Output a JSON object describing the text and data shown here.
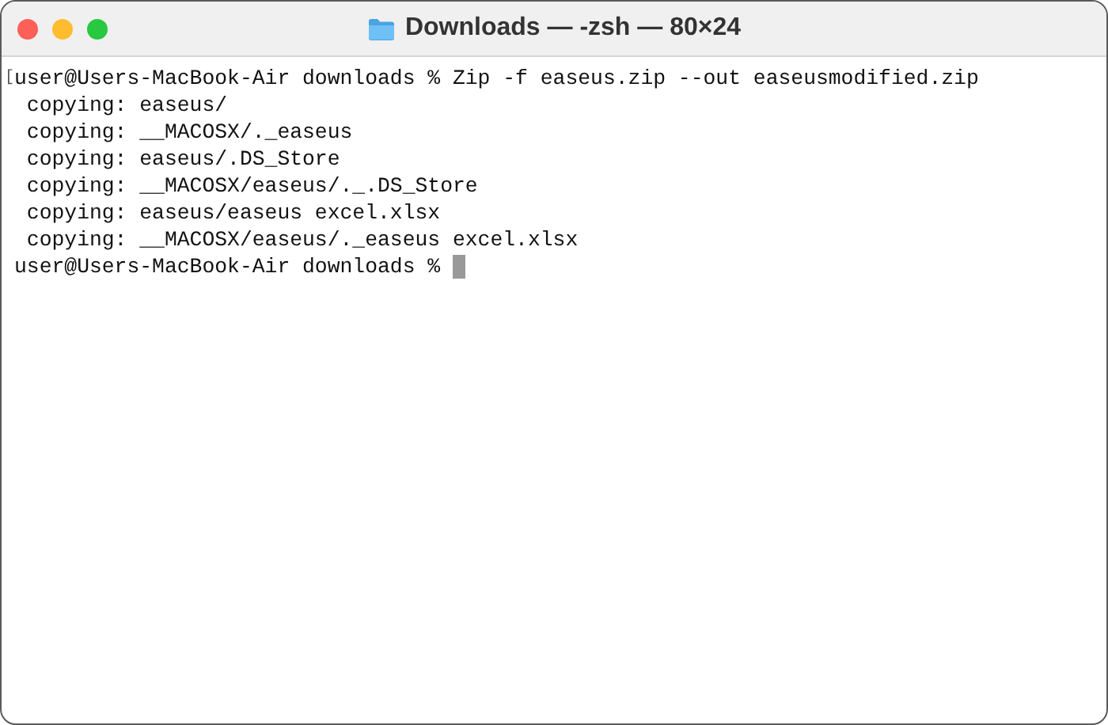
{
  "window": {
    "title": "Downloads — -zsh — 80×24"
  },
  "terminal": {
    "mark": "[",
    "lines": [
      {
        "text": "user@Users-MacBook-Air downloads % Zip -f easeus.zip --out easeusmodified.zip",
        "marked": true
      },
      {
        "text": " copying: easeus/",
        "marked": false
      },
      {
        "text": " copying: __MACOSX/._easeus",
        "marked": false
      },
      {
        "text": " copying: easeus/.DS_Store",
        "marked": false
      },
      {
        "text": " copying: __MACOSX/easeus/._.DS_Store",
        "marked": false
      },
      {
        "text": " copying: easeus/easeus excel.xlsx",
        "marked": false
      },
      {
        "text": " copying: __MACOSX/easeus/._easeus excel.xlsx",
        "marked": false
      },
      {
        "text": "user@Users-MacBook-Air downloads % ",
        "marked": false,
        "cursor": true
      }
    ]
  }
}
